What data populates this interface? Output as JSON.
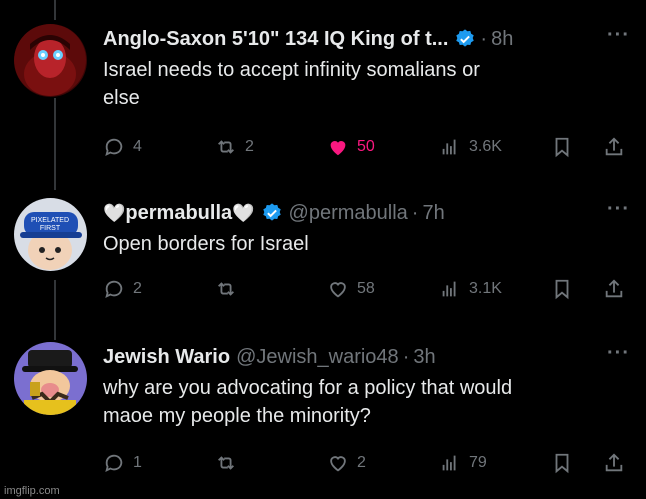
{
  "tweets": [
    {
      "name": "Anglo-Saxon 5'10\" 134 IQ King of t...",
      "handle": "",
      "time": "8h",
      "text_lines": [
        "Israel needs to accept infinity somalians or",
        "else"
      ],
      "replies": "4",
      "reposts": "2",
      "likes": "50",
      "views": "3.6K",
      "liked": true,
      "avatar_icon": "glowing-eyes-avatar"
    },
    {
      "name": "permabulla",
      "handle": "@permabulla",
      "time": "7h",
      "text_lines": [
        "Open borders for Israel"
      ],
      "replies": "2",
      "reposts": "",
      "likes": "58",
      "views": "3.1K",
      "liked": false,
      "avatar_icon": "cartoon-cap-avatar",
      "avatar_cap_text": [
        "PIXELATED",
        "FIRST"
      ]
    },
    {
      "name": "Jewish Wario",
      "handle": "@Jewish_wario48",
      "time": "3h",
      "text_lines": [
        "why are you advocating for a policy that would",
        "maoe my people the minority?"
      ],
      "replies": "1",
      "reposts": "",
      "likes": "2",
      "views": "79",
      "liked": false,
      "avatar_icon": "wario-avatar"
    }
  ],
  "watermark": "imgflip.com",
  "colors": {
    "accent": "#1d9bf0",
    "like": "#f91880",
    "muted": "#71767b",
    "text": "#e7e9ea"
  }
}
